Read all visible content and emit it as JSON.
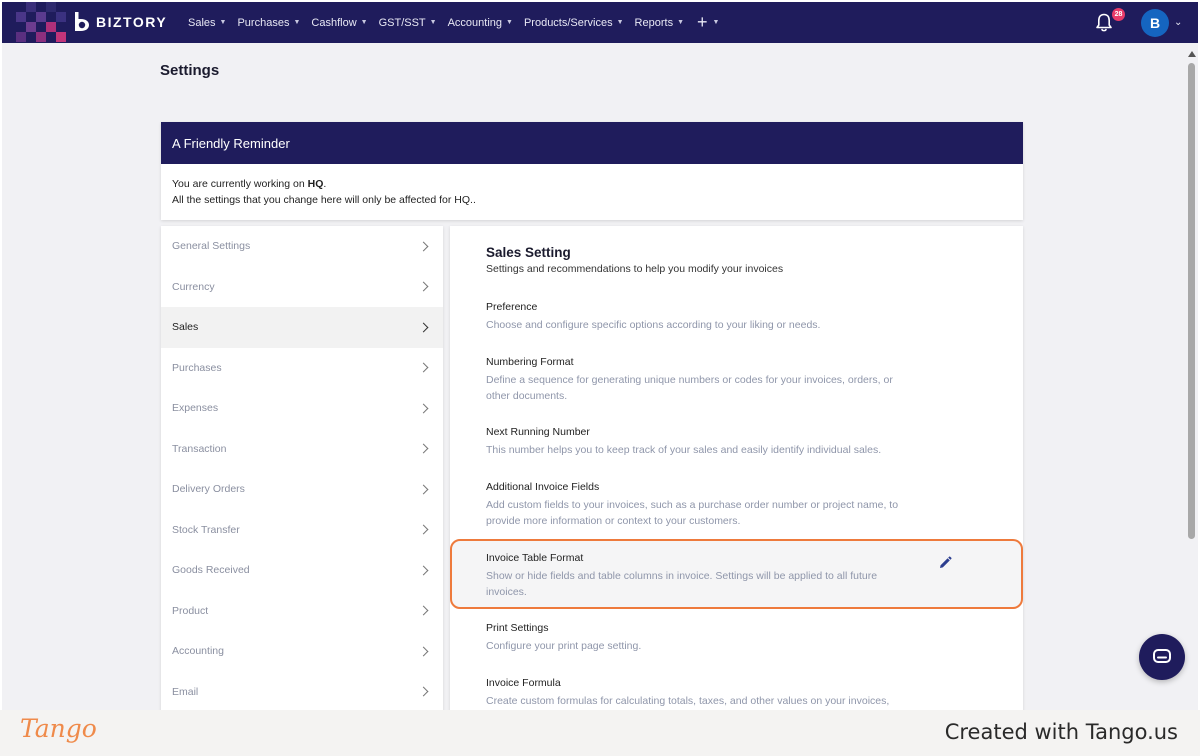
{
  "app": {
    "brand": "BIZTORY"
  },
  "nav": {
    "items": [
      {
        "label": "Sales"
      },
      {
        "label": "Purchases"
      },
      {
        "label": "Cashflow"
      },
      {
        "label": "GST/SST"
      },
      {
        "label": "Accounting"
      },
      {
        "label": "Products/Services"
      },
      {
        "label": "Reports"
      }
    ],
    "plus": "+",
    "notification_count": "28",
    "avatar_initial": "B"
  },
  "page": {
    "title": "Settings"
  },
  "reminder": {
    "title": "A Friendly Reminder",
    "line1_prefix": "You are currently working on ",
    "line1_branch": "HQ",
    "line1_suffix": ".",
    "line2": "All the settings that you change here will only be affected for HQ.."
  },
  "settings_menu": {
    "items": [
      {
        "label": "General Settings",
        "active": false
      },
      {
        "label": "Currency",
        "active": false
      },
      {
        "label": "Sales",
        "active": true
      },
      {
        "label": "Purchases",
        "active": false
      },
      {
        "label": "Expenses",
        "active": false
      },
      {
        "label": "Transaction",
        "active": false
      },
      {
        "label": "Delivery Orders",
        "active": false
      },
      {
        "label": "Stock Transfer",
        "active": false
      },
      {
        "label": "Goods Received",
        "active": false
      },
      {
        "label": "Product",
        "active": false
      },
      {
        "label": "Accounting",
        "active": false
      },
      {
        "label": "Email",
        "active": false
      }
    ]
  },
  "sales_setting": {
    "title": "Sales Setting",
    "subtitle": "Settings and recommendations to help you modify your invoices",
    "sections": [
      {
        "title": "Preference",
        "desc": "Choose and configure specific options according to your liking or needs."
      },
      {
        "title": "Numbering Format",
        "desc": "Define a sequence for generating unique numbers or codes for your invoices, orders, or other documents."
      },
      {
        "title": "Next Running Number",
        "desc": "This number helps you to keep track of your sales and easily identify individual sales."
      },
      {
        "title": "Additional Invoice Fields",
        "desc": "Add custom fields to your invoices, such as a purchase order number or project name, to provide more information or context to your customers."
      },
      {
        "title": "Invoice Table Format",
        "desc": "Show or hide fields and table columns in invoice. Settings will be applied to all future invoices."
      },
      {
        "title": "Print Settings",
        "desc": "Configure your print page setting."
      },
      {
        "title": "Invoice Formula",
        "desc": "Create custom formulas for calculating totals, taxes, and other values on your invoices,"
      }
    ]
  },
  "footer": {
    "logo": "Tango",
    "credit": "Created with Tango.us"
  },
  "colors": {
    "nav_bg": "#1f1c5c",
    "highlight": "#ee7a3c",
    "badge": "#e73b6a",
    "avatar": "#1565c0"
  }
}
